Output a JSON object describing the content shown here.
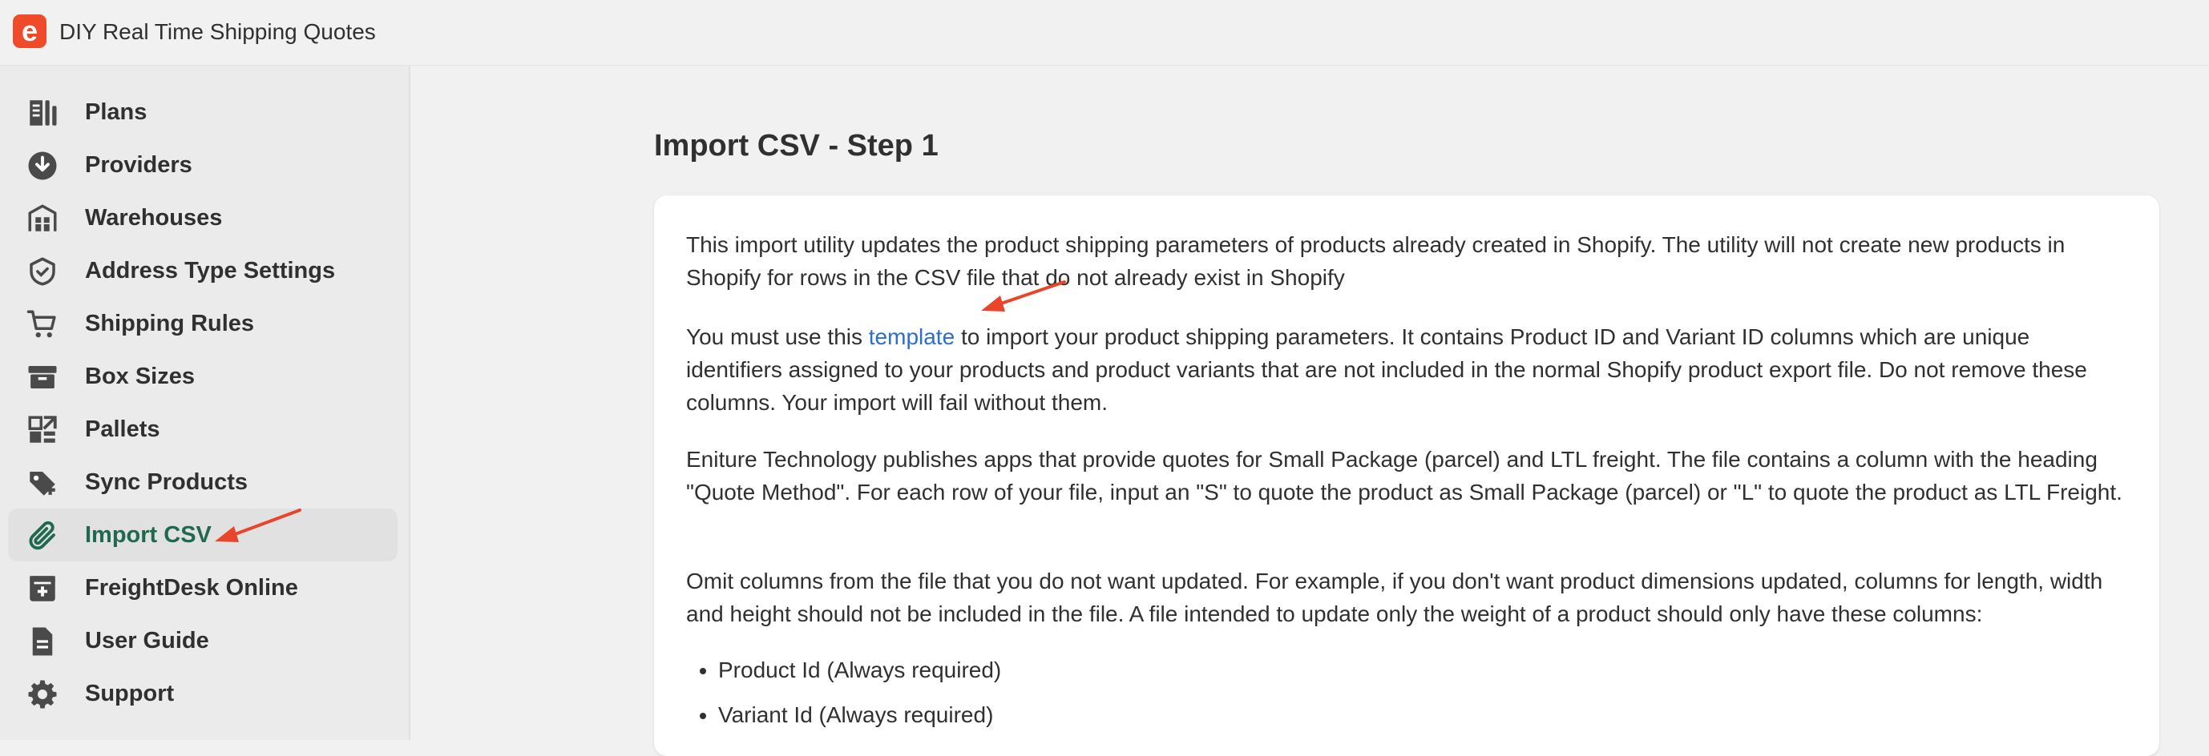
{
  "app": {
    "title": "DIY Real Time Shipping Quotes",
    "logo_letter": "e",
    "brand_color": "#ef4b2b"
  },
  "sidebar": {
    "items": [
      {
        "label": "Plans",
        "icon": "plans-icon",
        "active": false
      },
      {
        "label": "Providers",
        "icon": "download-circle-icon",
        "active": false
      },
      {
        "label": "Warehouses",
        "icon": "warehouse-icon",
        "active": false
      },
      {
        "label": "Address Type Settings",
        "icon": "shield-check-icon",
        "active": false
      },
      {
        "label": "Shipping Rules",
        "icon": "cart-icon",
        "active": false
      },
      {
        "label": "Box Sizes",
        "icon": "box-icon",
        "active": false
      },
      {
        "label": "Pallets",
        "icon": "pallets-icon",
        "active": false
      },
      {
        "label": "Sync Products",
        "icon": "tag-icon",
        "active": false
      },
      {
        "label": "Import CSV",
        "icon": "paperclip-icon",
        "active": true
      },
      {
        "label": "FreightDesk Online",
        "icon": "freightdesk-icon",
        "active": false
      },
      {
        "label": "User Guide",
        "icon": "document-icon",
        "active": false
      },
      {
        "label": "Support",
        "icon": "gear-icon",
        "active": false
      }
    ],
    "active_color": "#1f6a4f"
  },
  "main": {
    "title": "Import CSV - Step 1",
    "intro": "This import utility updates the product shipping parameters of products already created in Shopify. The utility will not create new products in Shopify for rows in the CSV file that do not already exist in Shopify",
    "template_prefix": "You must use this ",
    "template_link": "template",
    "template_suffix": " to import your product shipping parameters. It contains Product ID and Variant ID columns which are unique identifiers assigned to your products and product variants that are not included in the normal Shopify product export file. Do not remove these columns. Your import will fail without them.",
    "quote_method": "Eniture Technology publishes apps that provide quotes for Small Package (parcel) and LTL freight. The file contains a column with the heading \"Quote Method\". For each row of your file, input an \"S\" to quote the product as Small Package (parcel) or \"L\" to quote the product as LTL Freight.",
    "omit": "Omit columns from the file that you do not want updated. For example, if you don't want product dimensions updated, columns for length, width and height should not be included in the file. A file intended to update only the weight of a product should only have these columns:",
    "columns": [
      "Product Id (Always required)",
      "Variant Id (Always required)"
    ],
    "link_color": "#2c6ecb"
  },
  "annotations": {
    "arrow_color": "#e8452c"
  }
}
